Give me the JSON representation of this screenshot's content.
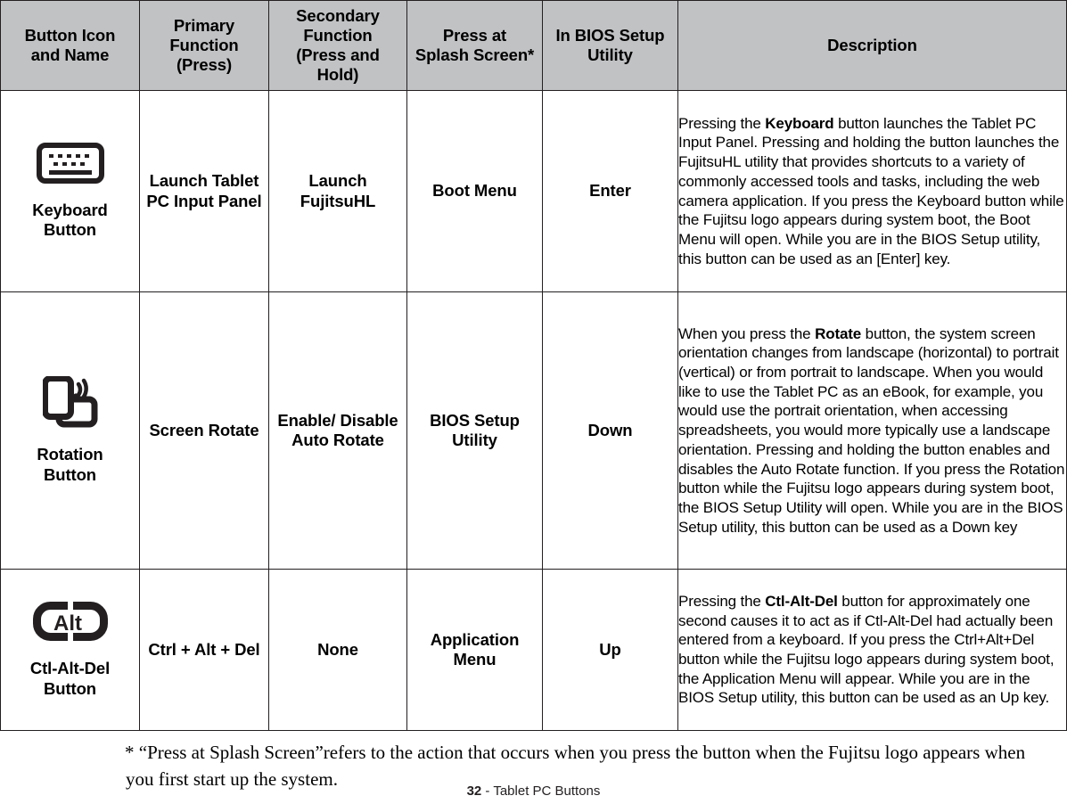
{
  "table": {
    "headers": [
      "Button Icon and Name",
      "Primary Function (Press)",
      "Secondary Function (Press and Hold)",
      "Press at Splash Screen*",
      "In BIOS Setup Utility",
      "Description"
    ],
    "header_lines": {
      "icon": [
        "Button Icon",
        "and Name"
      ],
      "primary": [
        "Primary",
        "Function",
        "(Press)"
      ],
      "secondary": [
        "Secondary",
        "Function",
        "(Press and",
        "Hold)"
      ],
      "splash": [
        "Press at",
        "Splash Screen*"
      ],
      "bios": [
        "In BIOS Setup",
        "Utility"
      ],
      "description": [
        "Description"
      ]
    },
    "rows": [
      {
        "icon_name": "keyboard-button-icon",
        "name_lines": [
          "Keyboard",
          "Button"
        ],
        "primary": "Launch Tablet PC Input Panel",
        "secondary": "Launch FujitsuHL",
        "splash": "Boot Menu",
        "bios": "Enter",
        "description_parts": [
          {
            "text": "Pressing the ",
            "bold": false
          },
          {
            "text": "Keyboard",
            "bold": true
          },
          {
            "text": " button launches the Tablet PC Input Panel. Pressing and holding the button launches the FujitsuHL utility that provides shortcuts to a variety of commonly accessed tools and tasks, including the web camera application. If you press the Keyboard button while the Fujitsu logo appears during system boot, the Boot Menu will open. While you are in the BIOS Setup utility, this button can be used as an [Enter] key.",
            "bold": false
          }
        ]
      },
      {
        "icon_name": "rotation-button-icon",
        "name_lines": [
          "Rotation",
          "Button"
        ],
        "primary": "Screen Rotate",
        "secondary": "Enable/ Disable Auto Rotate",
        "splash": "BIOS Setup Utility",
        "bios": "Down",
        "description_parts": [
          {
            "text": "When you press the ",
            "bold": false
          },
          {
            "text": "Rotate",
            "bold": true
          },
          {
            "text": " button, the system screen orientation changes from landscape (horizontal) to portrait (vertical) or from portrait to landscape. When you would like to use the Tablet PC as an eBook, for example, you would use the portrait orientation, when accessing spreadsheets, you would more typically use a landscape orientation. Pressing and holding the button enables and disables the Auto Rotate function. If you press the Rotation button while the Fujitsu logo appears during system boot, the BIOS Setup Utility will open. While you are in the BIOS Setup utility, this button can be used as a Down key",
            "bold": false
          }
        ]
      },
      {
        "icon_name": "ctl-alt-del-button-icon",
        "icon_text": "Alt",
        "name_lines": [
          "Ctl-Alt-Del",
          "Button"
        ],
        "primary": "Ctrl + Alt + Del",
        "secondary": "None",
        "splash": "Application Menu",
        "bios": "Up",
        "description_parts": [
          {
            "text": "Pressing the ",
            "bold": false
          },
          {
            "text": "Ctl-Alt-Del",
            "bold": true
          },
          {
            "text": " button for approximately one second causes it to act as if Ctl-Alt-Del had actually been entered from a keyboard. If you press the Ctrl+Alt+Del button while the Fujitsu logo appears during system boot, the Application Menu will appear. While you are in the BIOS Setup utility, this button can be used as an Up key.",
            "bold": false
          }
        ]
      }
    ]
  },
  "footnote": "* “Press at Splash Screen”refers to the action that occurs when you press the button when the Fujitsu logo appears when you first start up the system.",
  "page_footer": {
    "page_number": "32",
    "separator": " - ",
    "title": "Tablet PC Buttons"
  },
  "colors": {
    "header_background": "#c1c2c4",
    "border": "#231f20",
    "text": "#000000",
    "page_background": "#ffffff"
  }
}
